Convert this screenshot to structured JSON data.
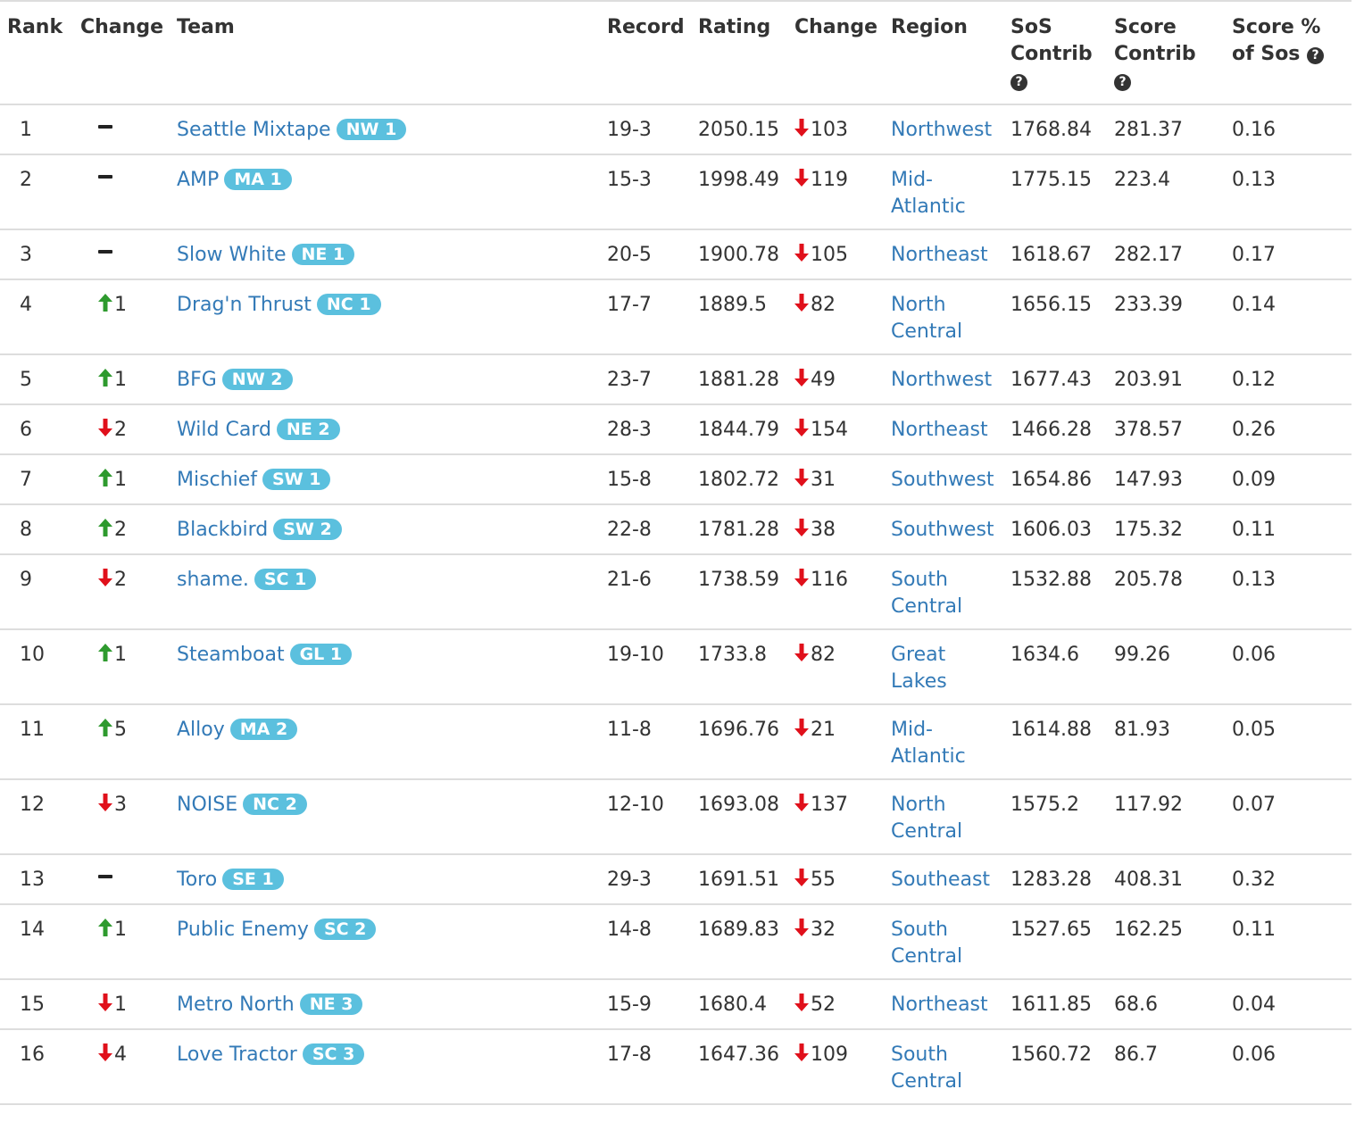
{
  "columns": [
    "Rank",
    "Change",
    "Team",
    "Record",
    "Rating",
    "Change",
    "Region",
    "SoS Contrib",
    "Score Contrib",
    "Score % of Sos"
  ],
  "help_icon": "question-circle-icon",
  "colors": {
    "link": "#337ab7",
    "badge": "#5bc0de",
    "up": "#2e9a2e",
    "down": "#e0101b"
  },
  "rows": [
    {
      "rank": "1",
      "change_dir": "none",
      "change_val": "",
      "team": "Seattle Mixtape",
      "badge": "NW 1",
      "record": "19-3",
      "rating": "2050.15",
      "rating_change_dir": "down",
      "rating_change": "103",
      "region": "Northwest",
      "sos_contrib": "1768.84",
      "score_contrib": "281.37",
      "score_pct": "0.16"
    },
    {
      "rank": "2",
      "change_dir": "none",
      "change_val": "",
      "team": "AMP",
      "badge": "MA 1",
      "record": "15-3",
      "rating": "1998.49",
      "rating_change_dir": "down",
      "rating_change": "119",
      "region": "Mid-Atlantic",
      "sos_contrib": "1775.15",
      "score_contrib": "223.4",
      "score_pct": "0.13"
    },
    {
      "rank": "3",
      "change_dir": "none",
      "change_val": "",
      "team": "Slow White",
      "badge": "NE 1",
      "record": "20-5",
      "rating": "1900.78",
      "rating_change_dir": "down",
      "rating_change": "105",
      "region": "Northeast",
      "sos_contrib": "1618.67",
      "score_contrib": "282.17",
      "score_pct": "0.17"
    },
    {
      "rank": "4",
      "change_dir": "up",
      "change_val": "1",
      "team": "Drag'n Thrust",
      "badge": "NC 1",
      "record": "17-7",
      "rating": "1889.5",
      "rating_change_dir": "down",
      "rating_change": "82",
      "region": "North Central",
      "sos_contrib": "1656.15",
      "score_contrib": "233.39",
      "score_pct": "0.14"
    },
    {
      "rank": "5",
      "change_dir": "up",
      "change_val": "1",
      "team": "BFG",
      "badge": "NW 2",
      "record": "23-7",
      "rating": "1881.28",
      "rating_change_dir": "down",
      "rating_change": "49",
      "region": "Northwest",
      "sos_contrib": "1677.43",
      "score_contrib": "203.91",
      "score_pct": "0.12"
    },
    {
      "rank": "6",
      "change_dir": "down",
      "change_val": "2",
      "team": "Wild Card",
      "badge": "NE 2",
      "record": "28-3",
      "rating": "1844.79",
      "rating_change_dir": "down",
      "rating_change": "154",
      "region": "Northeast",
      "sos_contrib": "1466.28",
      "score_contrib": "378.57",
      "score_pct": "0.26"
    },
    {
      "rank": "7",
      "change_dir": "up",
      "change_val": "1",
      "team": "Mischief",
      "badge": "SW 1",
      "record": "15-8",
      "rating": "1802.72",
      "rating_change_dir": "down",
      "rating_change": "31",
      "region": "Southwest",
      "sos_contrib": "1654.86",
      "score_contrib": "147.93",
      "score_pct": "0.09"
    },
    {
      "rank": "8",
      "change_dir": "up",
      "change_val": "2",
      "team": "Blackbird",
      "badge": "SW 2",
      "record": "22-8",
      "rating": "1781.28",
      "rating_change_dir": "down",
      "rating_change": "38",
      "region": "Southwest",
      "sos_contrib": "1606.03",
      "score_contrib": "175.32",
      "score_pct": "0.11"
    },
    {
      "rank": "9",
      "change_dir": "down",
      "change_val": "2",
      "team": "shame.",
      "badge": "SC 1",
      "record": "21-6",
      "rating": "1738.59",
      "rating_change_dir": "down",
      "rating_change": "116",
      "region": "South Central",
      "sos_contrib": "1532.88",
      "score_contrib": "205.78",
      "score_pct": "0.13"
    },
    {
      "rank": "10",
      "change_dir": "up",
      "change_val": "1",
      "team": "Steamboat",
      "badge": "GL 1",
      "record": "19-10",
      "rating": "1733.8",
      "rating_change_dir": "down",
      "rating_change": "82",
      "region": "Great Lakes",
      "sos_contrib": "1634.6",
      "score_contrib": "99.26",
      "score_pct": "0.06"
    },
    {
      "rank": "11",
      "change_dir": "up",
      "change_val": "5",
      "team": "Alloy",
      "badge": "MA 2",
      "record": "11-8",
      "rating": "1696.76",
      "rating_change_dir": "down",
      "rating_change": "21",
      "region": "Mid-Atlantic",
      "sos_contrib": "1614.88",
      "score_contrib": "81.93",
      "score_pct": "0.05"
    },
    {
      "rank": "12",
      "change_dir": "down",
      "change_val": "3",
      "team": "NOISE",
      "badge": "NC 2",
      "record": "12-10",
      "rating": "1693.08",
      "rating_change_dir": "down",
      "rating_change": "137",
      "region": "North Central",
      "sos_contrib": "1575.2",
      "score_contrib": "117.92",
      "score_pct": "0.07"
    },
    {
      "rank": "13",
      "change_dir": "none",
      "change_val": "",
      "team": "Toro",
      "badge": "SE 1",
      "record": "29-3",
      "rating": "1691.51",
      "rating_change_dir": "down",
      "rating_change": "55",
      "region": "Southeast",
      "sos_contrib": "1283.28",
      "score_contrib": "408.31",
      "score_pct": "0.32"
    },
    {
      "rank": "14",
      "change_dir": "up",
      "change_val": "1",
      "team": "Public Enemy",
      "badge": "SC 2",
      "record": "14-8",
      "rating": "1689.83",
      "rating_change_dir": "down",
      "rating_change": "32",
      "region": "South Central",
      "sos_contrib": "1527.65",
      "score_contrib": "162.25",
      "score_pct": "0.11"
    },
    {
      "rank": "15",
      "change_dir": "down",
      "change_val": "1",
      "team": "Metro North",
      "badge": "NE 3",
      "record": "15-9",
      "rating": "1680.4",
      "rating_change_dir": "down",
      "rating_change": "52",
      "region": "Northeast",
      "sos_contrib": "1611.85",
      "score_contrib": "68.6",
      "score_pct": "0.04"
    },
    {
      "rank": "16",
      "change_dir": "down",
      "change_val": "4",
      "team": "Love Tractor",
      "badge": "SC 3",
      "record": "17-8",
      "rating": "1647.36",
      "rating_change_dir": "down",
      "rating_change": "109",
      "region": "South Central",
      "sos_contrib": "1560.72",
      "score_contrib": "86.7",
      "score_pct": "0.06"
    }
  ]
}
